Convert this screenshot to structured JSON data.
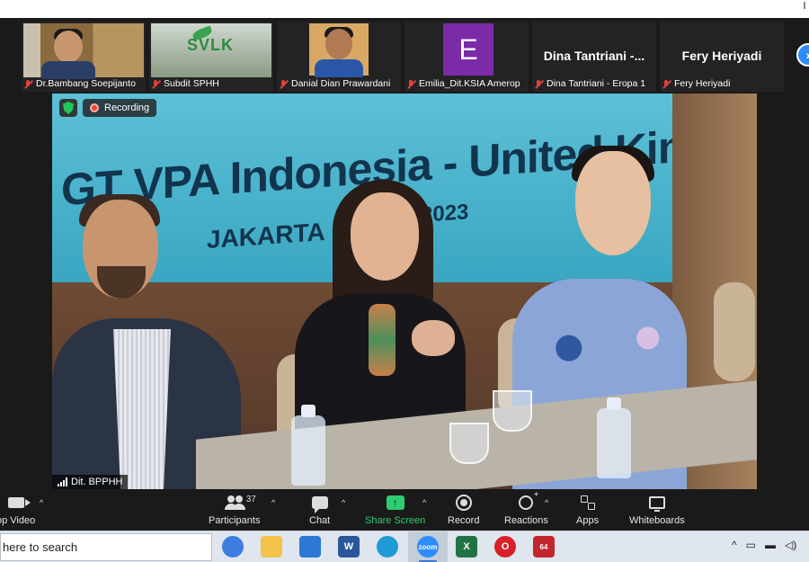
{
  "participants": [
    {
      "name": "Dr.Bambang Soepijanto",
      "kind": "video-bambang"
    },
    {
      "name": "Subdit SPHH",
      "kind": "video-svlk"
    },
    {
      "name": "Danial Dian Prawardani",
      "kind": "video-danial"
    },
    {
      "name": "Emilia_Dit.KSIA Amerop",
      "kind": "avatar",
      "avatar_letter": "E",
      "avatar_color": "#7b2aa8"
    },
    {
      "name": "Dina Tantriani - Eropa 1",
      "kind": "text",
      "display_name": "Dina Tantriani  -..."
    },
    {
      "name": "Fery Heriyadi",
      "kind": "text",
      "display_name": "Fery Heriyadi"
    }
  ],
  "svlk_logo_text": "SVLK",
  "next_page_icon": "chevron-right-icon",
  "main_video": {
    "banner_title": "GT VPA Indonesia - United Kingd",
    "banner_place": "JAKARTA ,",
    "banner_year": "2023",
    "recording_label": "Recording",
    "speaker_name": "Dit. BPPHH"
  },
  "toolbar": {
    "stop_video": "op Video",
    "participants": "Participants",
    "participants_count": "37",
    "chat": "Chat",
    "share_screen": "Share Screen",
    "record": "Record",
    "reactions": "Reactions",
    "apps": "Apps",
    "whiteboards": "Whiteboards",
    "accent_share": "#2ecc71"
  },
  "taskbar": {
    "search_placeholder": "here to search",
    "apps": [
      {
        "name": "chrome-like",
        "label": ""
      },
      {
        "name": "file-explorer",
        "label": ""
      },
      {
        "name": "mail",
        "label": ""
      },
      {
        "name": "word",
        "label": "W"
      },
      {
        "name": "edge",
        "label": ""
      },
      {
        "name": "zoom",
        "label": "zoom"
      },
      {
        "name": "excel",
        "label": "X"
      },
      {
        "name": "opera",
        "label": "O"
      },
      {
        "name": "app-64",
        "label": "64"
      }
    ]
  }
}
